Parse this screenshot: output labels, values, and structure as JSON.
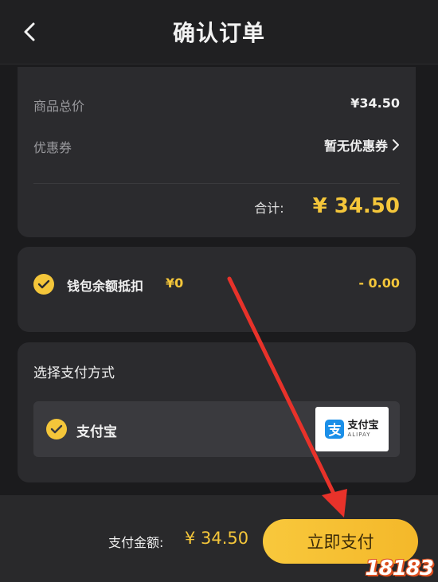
{
  "header": {
    "title": "确认订单",
    "back_icon": "chevron-left-icon"
  },
  "price_card": {
    "goods_total_label": "商品总价",
    "goods_total_value": "¥34.50",
    "coupon_label": "优惠券",
    "coupon_value": "暂无优惠券",
    "subtotal_label": "合计:",
    "subtotal_value": "¥ 34.50"
  },
  "wallet": {
    "label": "钱包余额抵扣",
    "balance": "¥0",
    "deduction": "- 0.00",
    "checked": true
  },
  "payment": {
    "section_title": "选择支付方式",
    "option_label": "支付宝",
    "logo_text": "支付宝",
    "logo_subtext": "ALIPAY",
    "checked": true
  },
  "footer": {
    "amount_label": "支付金额:",
    "amount_value": "¥ 34.50",
    "pay_button_label": "立即支付"
  },
  "watermark": "18183",
  "colors": {
    "accent": "#f4c63a",
    "background": "#1b1b1d",
    "card": "#2b2b2e",
    "arrow": "#e8322a"
  }
}
